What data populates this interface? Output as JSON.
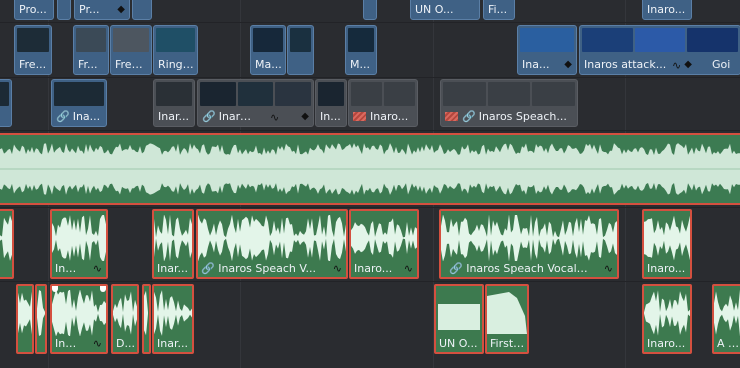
{
  "tracks": {
    "video3": [
      {
        "label": "Pro..."
      },
      {
        "label": "Pr..."
      },
      {
        "label": "UN O..."
      },
      {
        "label": "Fi..."
      },
      {
        "label": "Inaro..."
      }
    ],
    "video2": [
      {
        "label": "Fre..."
      },
      {
        "label": "Fr..."
      },
      {
        "label": "Fred..."
      },
      {
        "label": "Ring ..."
      },
      {
        "label": "Ma..."
      },
      {
        "label": "M..."
      },
      {
        "label": "Ina..."
      },
      {
        "label": "Inaros attack..."
      },
      {
        "label": "Goi"
      }
    ],
    "video1": [
      {
        "label": "Ina..."
      },
      {
        "label": "Inar..."
      },
      {
        "label": "Inaro..."
      },
      {
        "label": "In..."
      },
      {
        "label": "Inaro..."
      },
      {
        "label": "Inaros Speach..."
      }
    ],
    "audio_vocals": [
      {
        "label": "Ina..."
      },
      {
        "label": "Inar..."
      },
      {
        "label": "Inaros Speach V..."
      },
      {
        "label": "Inaro..."
      },
      {
        "label": "Inaros Speach Vocals ..."
      },
      {
        "label": "Inaro..."
      }
    ],
    "audio_fx": [
      {
        "label": "Ina..."
      },
      {
        "label": "D..."
      },
      {
        "label": "Inar..."
      },
      {
        "label": "UN O..."
      },
      {
        "label": "First ..."
      },
      {
        "label": "Inaro..."
      },
      {
        "label": "A Ri..."
      }
    ]
  },
  "icons": {
    "link": "link-icon",
    "keyframe": "keyframe-diamond-icon",
    "curve": "fade-curve-icon",
    "flag": "flag-icon"
  },
  "colors": {
    "video_clip": "#3f6185",
    "audio_clip": "#3d7a4f",
    "selection_border": "#d4503f",
    "waveform": "#dff3e6"
  }
}
